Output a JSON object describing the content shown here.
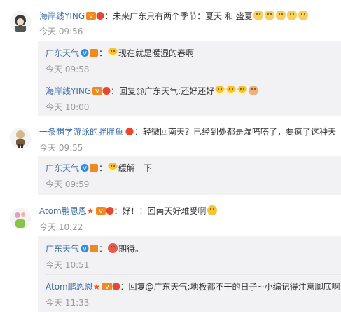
{
  "comments": [
    {
      "user": "海岸线YING",
      "text": "：未来广东只有两个季节：夏天 和 盛夏",
      "time": "今天 09:56",
      "replies": [
        {
          "user": "广东天气",
          "text": "现在就是暖湿的春啊",
          "time": "今天 09:58"
        },
        {
          "user": "海岸线YING",
          "text": "：回复@广东天气:还好还好",
          "time": "今天 10:00"
        }
      ]
    },
    {
      "user": "一条想学游泳的胖胖鱼",
      "text": "：轻微回南天？已经到处都是湿嗒嗒了，要疯了这种天",
      "time": "今天 09:55",
      "replies": [
        {
          "user": "广东天气",
          "text": "缓解一下",
          "time": "今天 09:59"
        }
      ]
    },
    {
      "user": "Atom鹏恩恩",
      "text": "：好！！回南天好难受啊",
      "time": "今天 10:22",
      "replies": [
        {
          "user": "广东天气",
          "text": "期待。",
          "time": "今天 10:51"
        },
        {
          "user": "Atom鹏恩恩",
          "text": "：回复@广东天气:地板都不干的日子~小编记得注意脚底啊",
          "time": "今天 11:33"
        }
      ]
    }
  ],
  "colors": {
    "username": "#3f6ea8",
    "time": "#999999",
    "reply_bg": "#f2f2f5"
  }
}
